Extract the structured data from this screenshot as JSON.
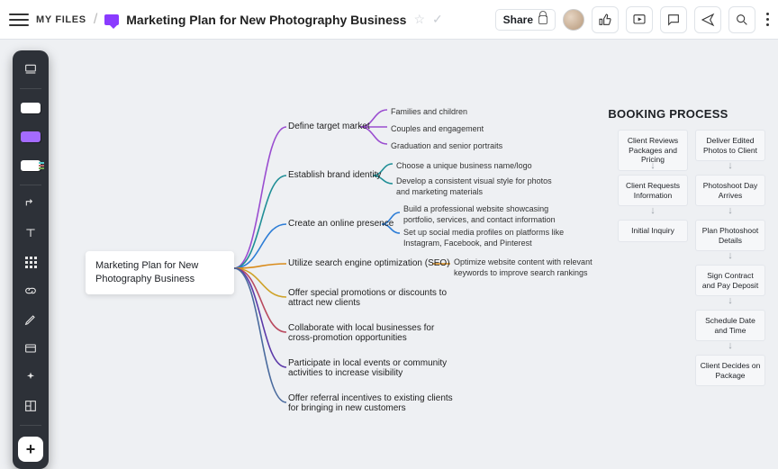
{
  "header": {
    "breadcrumb_root": "MY FILES",
    "title": "Marketing Plan for New Photography Business",
    "share_label": "Share"
  },
  "mindmap": {
    "root": "Marketing Plan for New Photography Business",
    "branches": [
      {
        "label": "Define target market",
        "color": "var(--c1)",
        "children": [
          "Families and children",
          "Couples and engagement",
          "Graduation and senior portraits"
        ]
      },
      {
        "label": "Establish brand identity",
        "color": "var(--c2)",
        "children": [
          "Choose a unique business name/logo",
          "Develop a consistent visual style for photos and marketing materials"
        ]
      },
      {
        "label": "Create an online presence",
        "color": "var(--c3)",
        "children": [
          "Build a professional website showcasing portfolio, services, and contact information",
          "Set up social media profiles on platforms like Instagram, Facebook, and Pinterest"
        ]
      },
      {
        "label": "Utilize search engine optimization (SEO)",
        "color": "var(--c4)",
        "children": [
          "Optimize website content with relevant keywords to improve search rankings"
        ]
      },
      {
        "label": "Offer special promotions or discounts to attract new clients",
        "color": "var(--c5)",
        "children": []
      },
      {
        "label": "Collaborate with local businesses for cross-promotion opportunities",
        "color": "var(--c6)",
        "children": []
      },
      {
        "label": "Participate in local events or community activities to increase visibility",
        "color": "var(--c7)",
        "children": []
      },
      {
        "label": "Offer referral incentives to existing clients for bringing in new customers",
        "color": "var(--c8)",
        "children": []
      }
    ]
  },
  "flow": {
    "title": "BOOKING PROCESS",
    "left": [
      "Client Reviews Packages and Pricing",
      "Client Requests Information",
      "Initial Inquiry"
    ],
    "right": [
      "Deliver Edited Photos to Client",
      "Photoshoot Day Arrives",
      "Plan Photoshoot Details",
      "Sign Contract and Pay Deposit",
      "Schedule Date and Time",
      "Client Decides on Package"
    ]
  }
}
